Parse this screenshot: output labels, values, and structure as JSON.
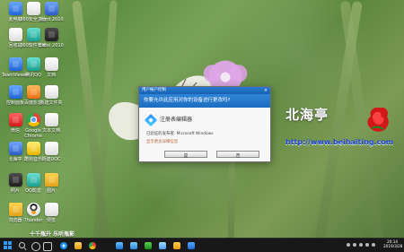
{
  "desktop": {
    "icons": [
      {
        "label": "此电脑"
      },
      {
        "label": "360安全卫士"
      },
      {
        "label": "Word 2010"
      },
      {
        "label": "回收站"
      },
      {
        "label": "360软件管家"
      },
      {
        "label": "Excel 2010"
      },
      {
        "label": "TeamViewer"
      },
      {
        "label": "腾讯QQ"
      },
      {
        "label": "文档"
      },
      {
        "label": "控制面板"
      },
      {
        "label": "百度影音"
      },
      {
        "label": "新建文件夹"
      },
      {
        "label": "微信"
      },
      {
        "label": "Google Chrome"
      },
      {
        "label": "文本文档"
      },
      {
        "label": "北海亭"
      },
      {
        "label": "酷狗音乐"
      },
      {
        "label": "新建DOC"
      },
      {
        "label": "照片"
      },
      {
        "label": "QQ影音"
      },
      {
        "label": "图片"
      },
      {
        "label": "浏览器"
      },
      {
        "label": "Thunder"
      },
      {
        "label": "便签"
      }
    ],
    "bottom_links": "十千瓶升 乐听瓶影"
  },
  "dialog": {
    "title": "用户帐户控制",
    "close_glyph": "×",
    "question": "你要允许此应用对你的设备进行更改吗?",
    "app_name": "注册表编辑器",
    "publisher": "已验证的发布者: Microsoft Windows",
    "details_link": "显示更多详细信息",
    "yes_label": "是",
    "no_label": "否"
  },
  "watermark": {
    "title": "北海亭",
    "url": "http://www.beihaiting.com"
  },
  "taskbar": {
    "clock_time": "20:14",
    "clock_date": "2019/3/28"
  },
  "colors": {
    "dialog_accent": "#1c6dc0",
    "taskbar_bg": "#181818",
    "watermark_url": "#2147db"
  }
}
